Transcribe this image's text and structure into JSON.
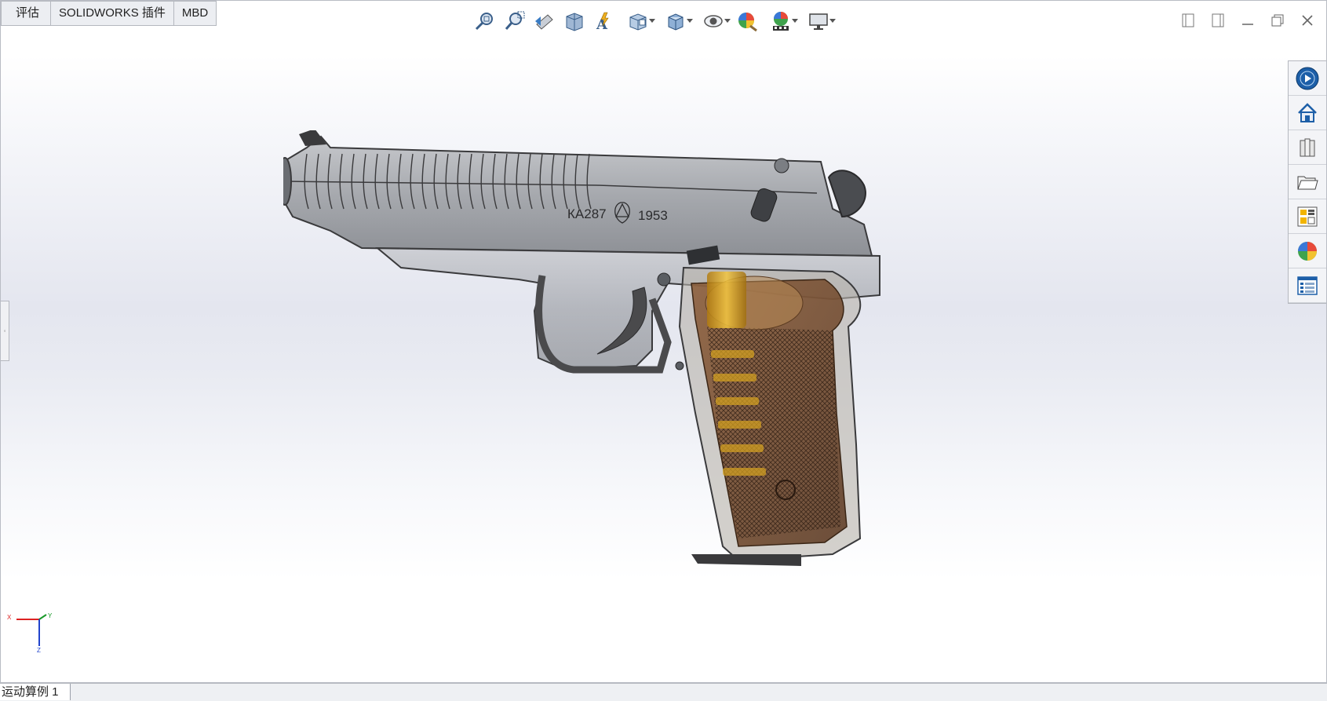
{
  "tabs": [
    {
      "label": "评估"
    },
    {
      "label": "SOLIDWORKS 插件"
    },
    {
      "label": "MBD"
    }
  ],
  "hud_icons": [
    "zoom-to-fit-icon",
    "zoom-to-area-icon",
    "previous-view-icon",
    "section-view-icon",
    "dynamic-annotation-icon",
    "view-orientation-icon",
    "display-style-icon",
    "hide-show-items-icon",
    "edit-appearance-icon",
    "apply-scene-icon",
    "view-settings-icon"
  ],
  "window_controls": [
    "tile-left-icon",
    "tile-right-icon",
    "minimize-icon",
    "restore-icon",
    "close-icon"
  ],
  "taskpane_icons": [
    "solidworks-resources-icon",
    "design-library-icon",
    "file-explorer-icon",
    "open-folder-icon",
    "view-palette-icon",
    "appearances-scenes-icon",
    "custom-properties-icon"
  ],
  "model": {
    "engraving_serial": "КА287",
    "engraving_year": "1953",
    "colors": {
      "body": "#8a8c90",
      "outline": "#3a3a3c",
      "grip": "#7a4a2a",
      "cartridge": "#d9a520"
    }
  },
  "triad": {
    "x": "X",
    "y": "Y",
    "z": "Z"
  },
  "bottom_tab": {
    "label": "运动算例 1"
  }
}
